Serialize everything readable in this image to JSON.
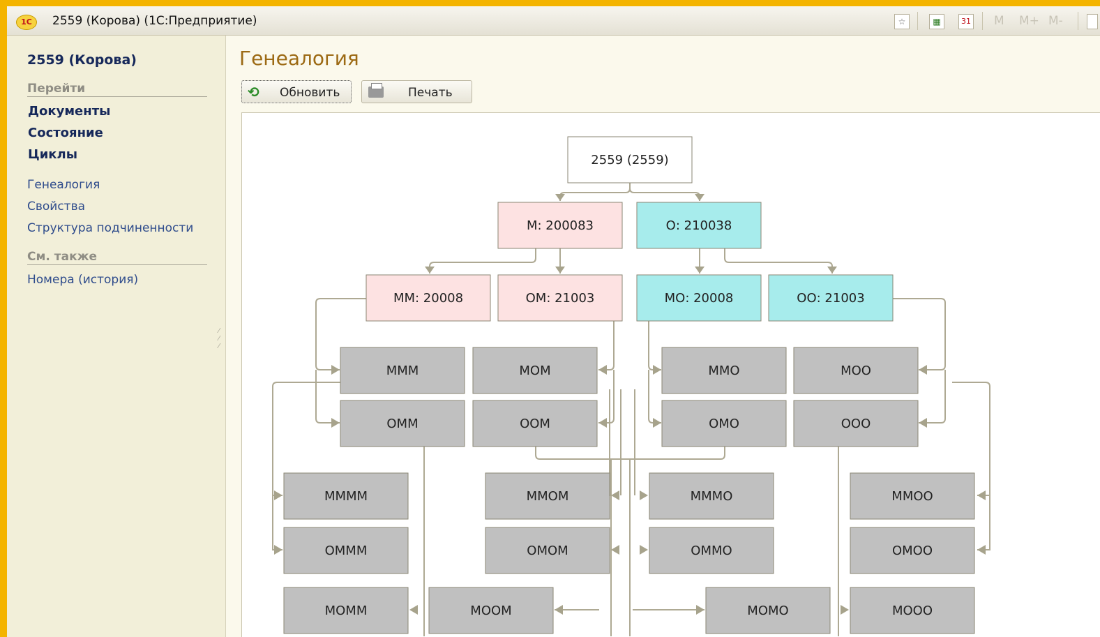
{
  "window": {
    "title": "2559 (Корова)  (1С:Предприятие)",
    "logo": "1С",
    "toolbar_icons": [
      "star-icon",
      "calculator-icon",
      "calendar-icon"
    ],
    "calendar_day": "31",
    "memory_buttons": [
      "M",
      "M+",
      "M-"
    ]
  },
  "sidebar": {
    "title": "2559 (Корова)",
    "section_go": "Перейти",
    "go_links": [
      "Документы",
      "Состояние",
      "Циклы"
    ],
    "links": [
      "Генеалогия",
      "Свойства",
      "Структура подчиненности"
    ],
    "section_see_also": "См. также",
    "see_also_links": [
      "Номера (история)"
    ]
  },
  "main": {
    "title": "Генеалогия",
    "refresh_label": "Обновить",
    "print_label": "Печать"
  },
  "colors": {
    "root": "#ffffff",
    "mother_line": "#fde2e2",
    "father_line": "#a7ecec",
    "unknown": "#c0c0c0",
    "connector": "#aea993",
    "accent_title": "#9c6a14"
  },
  "tree": {
    "root": {
      "label": "2559 (2559)",
      "color": "#ffffff"
    },
    "nodes": [
      {
        "id": "M",
        "label": "М: 200083",
        "color": "#fde2e2"
      },
      {
        "id": "O",
        "label": "О: 210038",
        "color": "#a7ecec"
      },
      {
        "id": "MM",
        "label": "ММ: 20008",
        "color": "#fde2e2"
      },
      {
        "id": "OM",
        "label": "ОМ: 21003",
        "color": "#fde2e2"
      },
      {
        "id": "MO",
        "label": "МО: 20008",
        "color": "#a7ecec"
      },
      {
        "id": "OO",
        "label": "ОО: 21003",
        "color": "#a7ecec"
      },
      {
        "id": "MMM",
        "label": "МММ",
        "color": "#c0c0c0"
      },
      {
        "id": "MOM",
        "label": "МОМ",
        "color": "#c0c0c0"
      },
      {
        "id": "MMO",
        "label": "ММО",
        "color": "#c0c0c0"
      },
      {
        "id": "MOO",
        "label": "МОО",
        "color": "#c0c0c0"
      },
      {
        "id": "OMM",
        "label": "ОММ",
        "color": "#c0c0c0"
      },
      {
        "id": "OOM",
        "label": "ООМ",
        "color": "#c0c0c0"
      },
      {
        "id": "OMO",
        "label": "ОМО",
        "color": "#c0c0c0"
      },
      {
        "id": "OOO",
        "label": "ООО",
        "color": "#c0c0c0"
      },
      {
        "id": "MMMM",
        "label": "ММММ",
        "color": "#c0c0c0"
      },
      {
        "id": "MMOM",
        "label": "ММОМ",
        "color": "#c0c0c0"
      },
      {
        "id": "MMMO",
        "label": "МММО",
        "color": "#c0c0c0"
      },
      {
        "id": "MMOO",
        "label": "ММОО",
        "color": "#c0c0c0"
      },
      {
        "id": "OMMM",
        "label": "ОМММ",
        "color": "#c0c0c0"
      },
      {
        "id": "OMOM",
        "label": "ОМОМ",
        "color": "#c0c0c0"
      },
      {
        "id": "OMMO",
        "label": "ОММО",
        "color": "#c0c0c0"
      },
      {
        "id": "OMOO",
        "label": "ОМОО",
        "color": "#c0c0c0"
      },
      {
        "id": "MOMM",
        "label": "МОММ",
        "color": "#c0c0c0"
      },
      {
        "id": "MOOM",
        "label": "МООМ",
        "color": "#c0c0c0"
      },
      {
        "id": "MOMO",
        "label": "МОМО",
        "color": "#c0c0c0"
      },
      {
        "id": "MOOO",
        "label": "МООО",
        "color": "#c0c0c0"
      }
    ]
  }
}
